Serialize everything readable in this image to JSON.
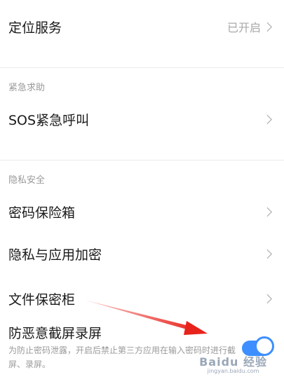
{
  "rows": {
    "location": {
      "label": "定位服务",
      "value": "已开启"
    },
    "sos": {
      "label": "SOS紧急呼叫"
    },
    "password_box": {
      "label": "密码保险箱"
    },
    "privacy_app_lock": {
      "label": "隐私与应用加密"
    },
    "file_safe": {
      "label": "文件保密柜"
    },
    "anti_screenshot": {
      "label": "防恶意截屏录屏",
      "desc": "为防止密码泄露，开启后禁止第三方应用在输入密码时进行截屏、录屏。",
      "enabled": true
    }
  },
  "sections": {
    "emergency": "紧急求助",
    "privacy": "隐私安全"
  },
  "watermark": {
    "logo": "Baidu 经验",
    "url": "jingyan.baidu.com"
  },
  "colors": {
    "accent": "#3d8fff",
    "arrow": "#e8231b"
  }
}
